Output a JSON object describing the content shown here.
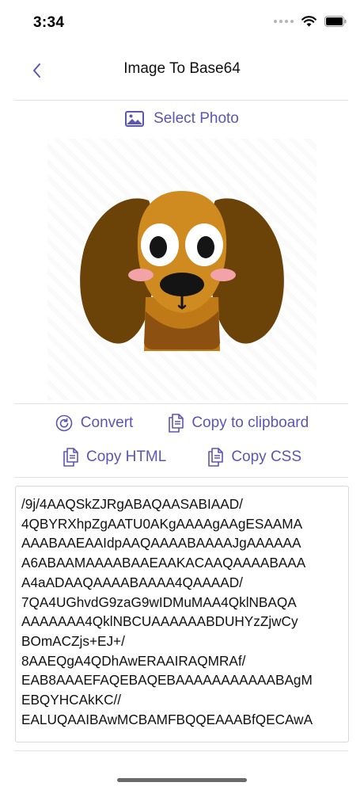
{
  "status_bar": {
    "time": "3:34"
  },
  "nav": {
    "title": "Image To Base64"
  },
  "select_photo": {
    "label": "Select Photo"
  },
  "actions": {
    "convert": "Convert",
    "copy_clipboard": "Copy to clipboard",
    "copy_html": "Copy HTML",
    "copy_css": "Copy CSS"
  },
  "output": {
    "text": "/9j/4AAQSkZJRgABAQAASABIAAD/\n4QBYRXhpZgAATU0AKgAAAAgAAgESAAMA\nAAABAAEAAIdpAAQAAAABAAAAJgAAAAAA\nA6ABAAMAAAABAAEAAKACAAQAAAABAAA\nA4aADAAQAAAABAAAA4QAAAAD/\n7QA4UGhvdG9zaG9wIDMuMAA4QklNBAQA\nAAAAAAA4QklNBCUAAAAAABDUHYzZjwCy\nBOmACZjs+EJ+/\n8AAEQgA4QDhAwERAAIRAQMRAf/\nEAB8AAAEFAQEBAQEBAAAAAAAAAAABAgM\nEBQYHCAkKC//\nEALUQAAIBAwMCBAMFBQQEAAABfQECAwA"
  },
  "colors": {
    "accent": "#5b55b5"
  },
  "icons": {
    "back": "chevron-left-icon",
    "photo": "photo-icon",
    "convert": "refresh-icon",
    "copy": "copy-icon"
  }
}
